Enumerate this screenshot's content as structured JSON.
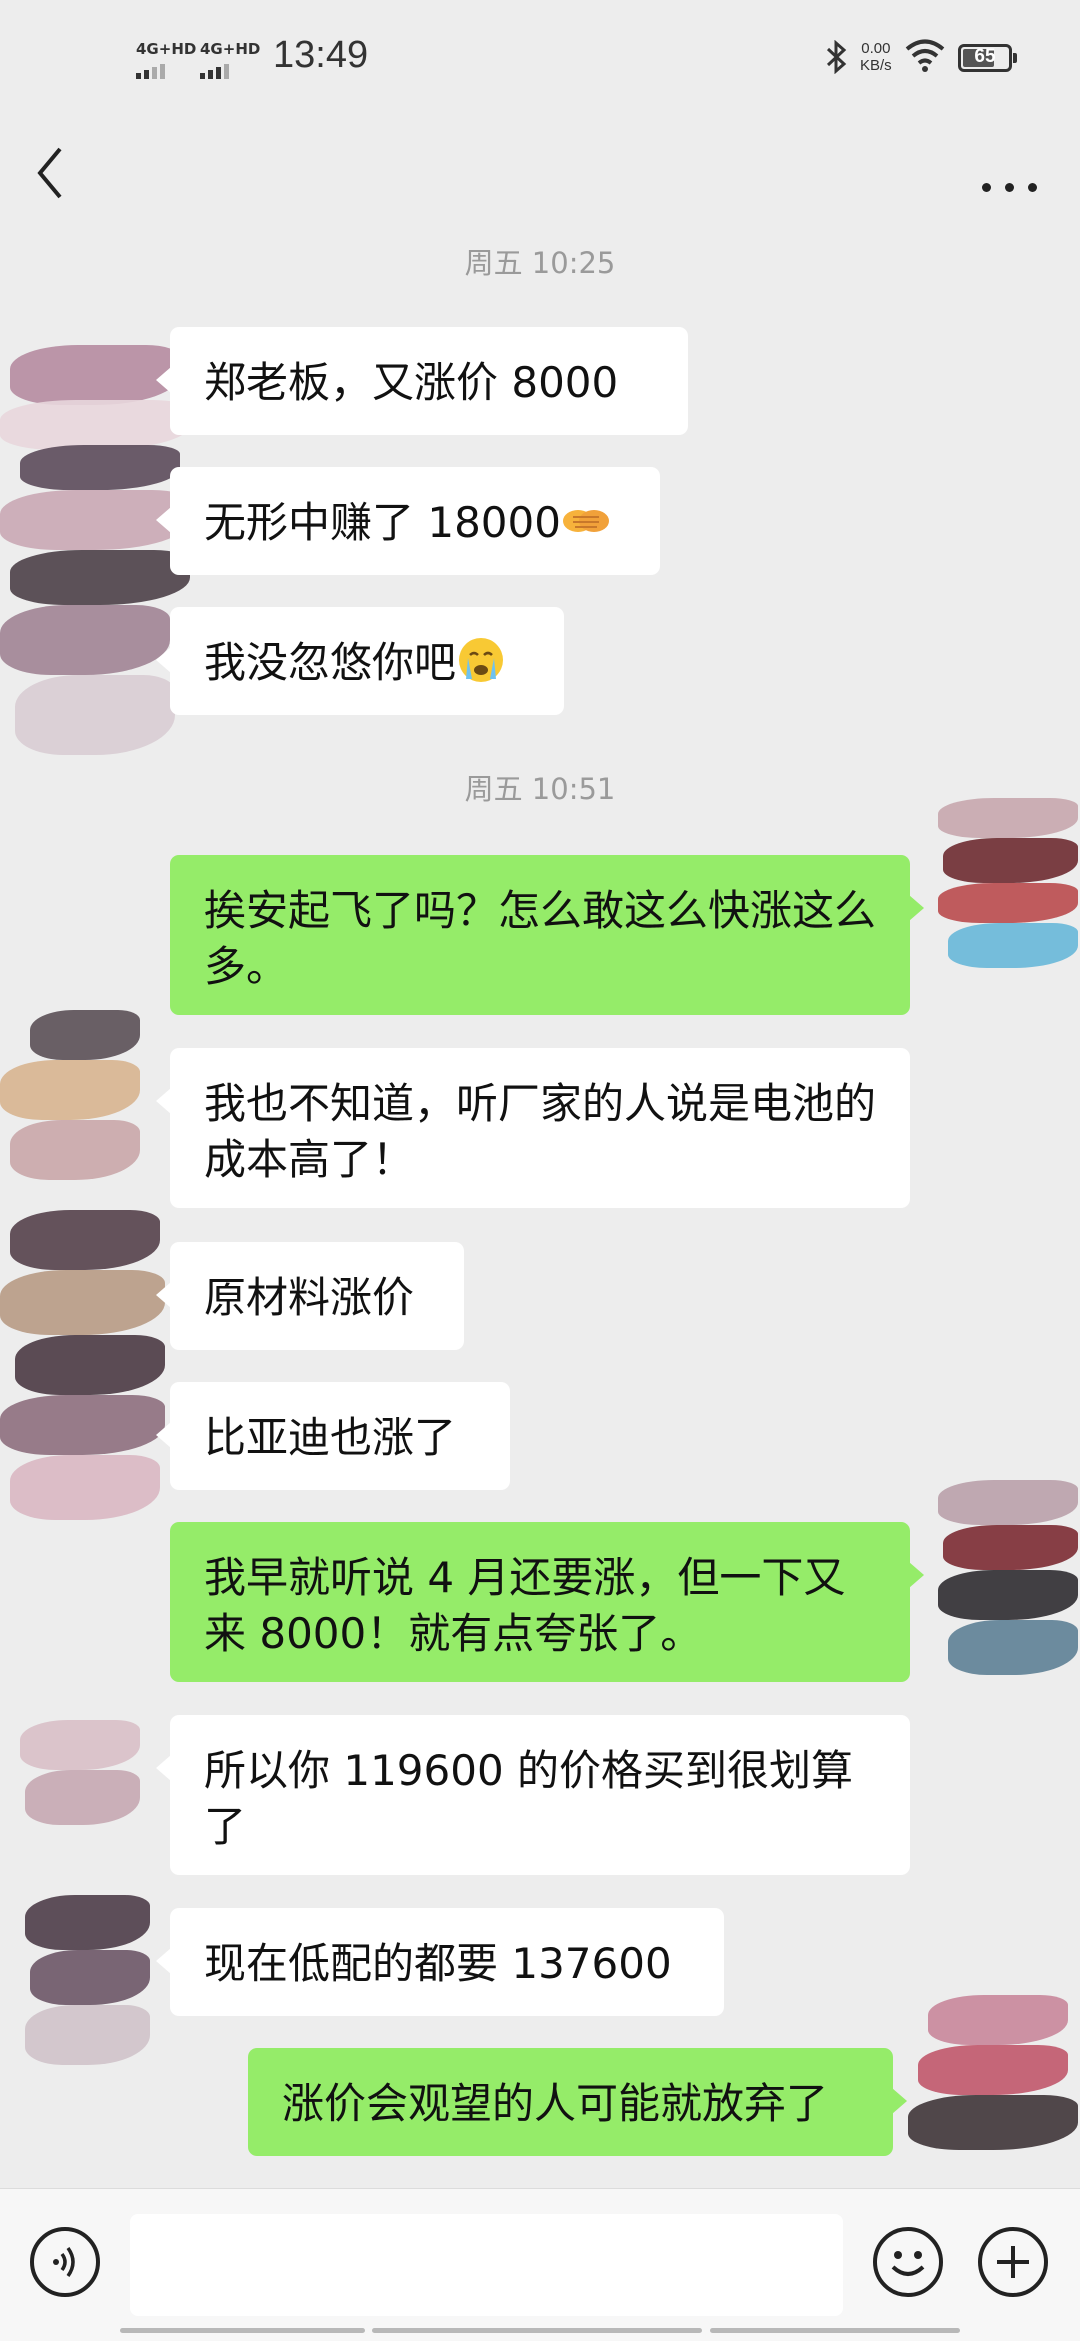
{
  "status_bar": {
    "time": "13:49",
    "signal_1": "4G+HD",
    "signal_2": "4G+HD",
    "net_speed_value": "0.00",
    "net_speed_unit": "KB/s",
    "battery": "65"
  },
  "header": {
    "back_icon": "chevron-left-icon",
    "more_icon": "more-dots-icon"
  },
  "messages": {
    "ts1": "周五 10:25",
    "m1": "郑老板，又涨价 8000",
    "m2": "无形中赚了 18000",
    "m3": "我没忽悠你吧",
    "ts2": "周五 10:51",
    "m4": "挨安起飞了吗？怎么敢这么快涨这么多。",
    "m5": "我也不知道，听厂家的人说是电池的成本高了！",
    "m6": "原材料涨价",
    "m7": "比亚迪也涨了",
    "m8": "我早就听说 4 月还要涨，但一下又来 8000！就有点夸张了。",
    "m9": "所以你 119600 的价格买到很划算了",
    "m10": "现在低配的都要 137600",
    "m11": "涨价会观望的人可能就放弃了"
  },
  "emojis": {
    "m2": "handshake-emoji",
    "m3": "crying-emoji"
  },
  "input_bar": {
    "voice_icon": "voice-icon",
    "text_value": "",
    "emoji_icon": "smiley-icon",
    "plus_icon": "plus-icon"
  },
  "colors": {
    "background": "#ededed",
    "incoming_bubble": "#ffffff",
    "outgoing_bubble": "#95ec69"
  }
}
